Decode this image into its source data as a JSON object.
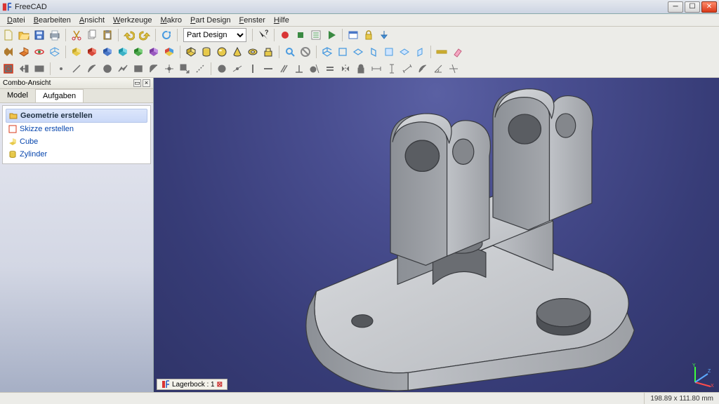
{
  "window": {
    "title": "FreeCAD"
  },
  "menu": {
    "items": [
      {
        "k": "D",
        "rest": "atei"
      },
      {
        "k": "B",
        "rest": "earbeiten"
      },
      {
        "k": "A",
        "rest": "nsicht"
      },
      {
        "k": "W",
        "rest": "erkzeuge"
      },
      {
        "k": "M",
        "rest": "akro"
      },
      {
        "k": "P",
        "rest": "art Design"
      },
      {
        "k": "F",
        "rest": "enster"
      },
      {
        "k": "H",
        "rest": "ilfe"
      }
    ]
  },
  "workbench": {
    "selected": "Part Design"
  },
  "side": {
    "title": "Combo-Ansicht",
    "tabs": {
      "model": "Model",
      "tasks": "Aufgaben"
    },
    "task_header": "Geometrie erstellen",
    "links": [
      {
        "icon": "sketch-icon",
        "label": "Skizze erstellen"
      },
      {
        "icon": "cube-icon",
        "label": "Cube"
      },
      {
        "icon": "cylinder-icon",
        "label": "Zylinder"
      }
    ]
  },
  "doc_tab": {
    "name": "Lagerbock : 1"
  },
  "status": {
    "dimensions": "198.89 x 111.80 mm"
  },
  "toolbar_icons_row1": [
    "new-file",
    "open-file",
    "save-file",
    "print",
    "cut",
    "copy",
    "paste",
    "undo",
    "redo",
    "refresh",
    "workbench-selector",
    "whatsthis",
    "macro-record",
    "macro-stop",
    "macro-list",
    "macro-play",
    "dialog",
    "lock",
    "arrow-down"
  ],
  "toolbar_icons_row2": [
    "shape-box",
    "shape-view1",
    "shape-view2",
    "shape-wireframe",
    "cube-yellow",
    "cube-red",
    "cube-blue",
    "cube-cyan",
    "cube-green",
    "cube-purple",
    "shape-compound",
    "box-primitive",
    "cylinder-primitive",
    "sphere-primitive",
    "cone-primitive",
    "torus-primitive",
    "part-extrude",
    "zoom-fit",
    "no-entry",
    "view-iso",
    "view-front",
    "view-top",
    "view-right",
    "view-rear",
    "view-bottom",
    "view-left",
    "measure",
    "erase"
  ],
  "toolbar_icons_row3": [
    "sketch",
    "sketch-leave",
    "sketch-view",
    "sketch-line",
    "sketch-arc",
    "sketch-circle",
    "sketch-polyline",
    "sketch-rect",
    "sketch-fillet",
    "sketch-trim",
    "sketch-external",
    "sketch-construction",
    "con-coincident",
    "con-point",
    "con-vertical",
    "con-horizontal",
    "con-parallel",
    "con-perp",
    "con-tangent",
    "con-equal",
    "con-symmetric",
    "con-lock",
    "con-hdist",
    "con-vdist",
    "con-length",
    "con-radius",
    "con-angle",
    "con-ref"
  ]
}
